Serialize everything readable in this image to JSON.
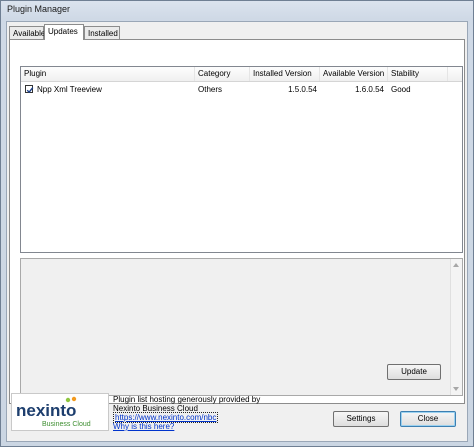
{
  "window": {
    "title": "Plugin Manager"
  },
  "tabs": [
    {
      "label": "Available",
      "active": false
    },
    {
      "label": "Updates",
      "active": true
    },
    {
      "label": "Installed",
      "active": false
    }
  ],
  "list": {
    "columns": [
      "Plugin",
      "Category",
      "Installed Version",
      "Available Version",
      "Stability"
    ],
    "rows": [
      {
        "checked": true,
        "plugin": "Npp Xml Treeview",
        "category": "Others",
        "installed": "1.5.0.54",
        "available": "1.6.0.54",
        "stability": "Good"
      }
    ]
  },
  "buttons": {
    "update": "Update",
    "settings": "Settings",
    "close": "Close"
  },
  "footer": {
    "line1": "Plugin list hosting generously provided by",
    "line2": "Nexinto Business Cloud",
    "url": "https://www.nexinto.com/nbc",
    "why": "Why is this here?"
  },
  "logo": {
    "brand": "nexinto",
    "tagline": "Business Cloud",
    "colors": {
      "navy": "#1d3e6e",
      "green": "#8ec63f",
      "orange": "#f39a1e"
    }
  }
}
